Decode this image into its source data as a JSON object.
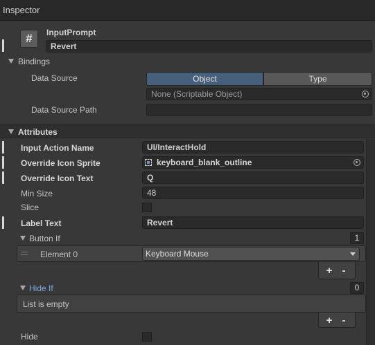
{
  "window": {
    "tab_title": "Inspector"
  },
  "component": {
    "icon_glyph": "#",
    "name": "InputPrompt",
    "text_value": "Revert"
  },
  "bindings": {
    "header": "Bindings",
    "data_source_label": "Data Source",
    "segments": [
      "Object",
      "Type"
    ],
    "object_field_value": "None (Scriptable Object)",
    "data_source_path_label": "Data Source Path",
    "data_source_path_value": ""
  },
  "attributes": {
    "header": "Attributes",
    "input_action_name": {
      "label": "Input Action Name",
      "value": "UI/InteractHold"
    },
    "override_icon_sprite": {
      "label": "Override Icon Sprite",
      "value": "keyboard_blank_outline"
    },
    "override_icon_text": {
      "label": "Override Icon Text",
      "value": "Q"
    },
    "min_size": {
      "label": "Min Size",
      "value": "48"
    },
    "slice": {
      "label": "Slice",
      "checked": false
    },
    "label_text": {
      "label": "Label Text",
      "value": "Revert"
    },
    "button_if": {
      "label": "Button If",
      "count": "1",
      "elements": [
        {
          "label": "Element 0",
          "value": "Keyboard Mouse"
        }
      ]
    },
    "hide_if": {
      "label": "Hide If",
      "count": "0",
      "empty_text": "List is empty"
    },
    "hide": {
      "label": "Hide",
      "checked": false
    },
    "add_button": "+",
    "remove_button": "-"
  },
  "colors": {
    "background": "#383838",
    "accent_blue": "#46607c",
    "link_blue": "#7fa7e8"
  }
}
